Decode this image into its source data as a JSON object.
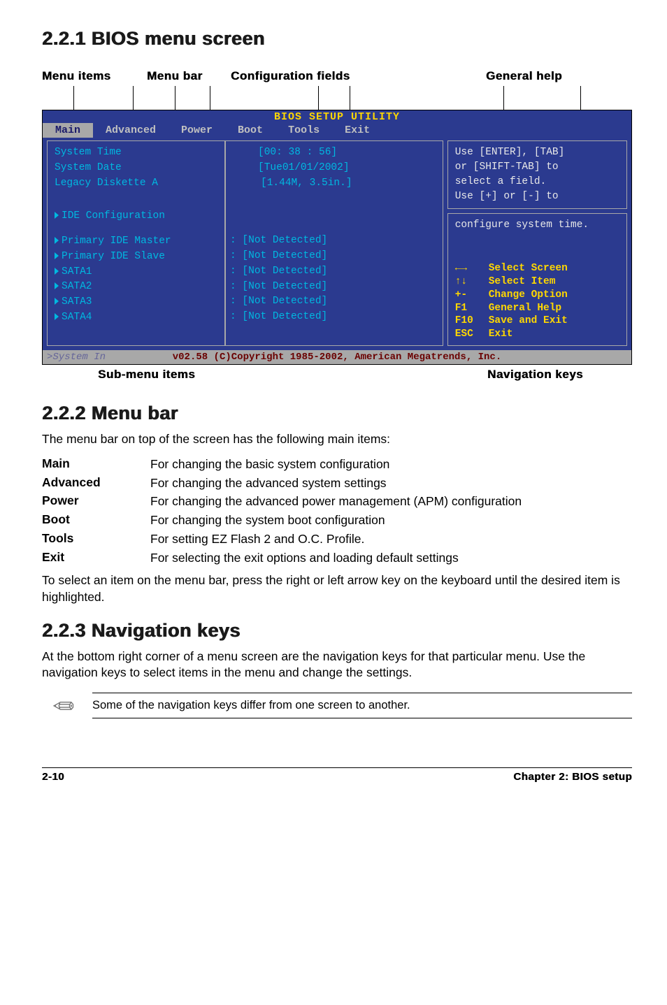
{
  "sec_221_title": "2.2.1  BIOS menu screen",
  "annot_top": {
    "menu_items": "Menu items",
    "menu_bar": "Menu bar",
    "config_fields": "Configuration fields",
    "general_help": "General help"
  },
  "bios": {
    "title": "BIOS SETUP UTILITY",
    "menubar": [
      "Main",
      "Advanced",
      "Power",
      "Boot",
      "Tools",
      "Exit"
    ],
    "left_labels": {
      "sys_time": "System Time",
      "sys_date": "System Date",
      "legacy": "Legacy Diskette A",
      "ide_cfg": "IDE Configuration",
      "pim": "Primary IDE Master",
      "pis": "Primary IDE Slave",
      "s1": "SATA1",
      "s2": "SATA2",
      "s3": "SATA3",
      "s4": "SATA4"
    },
    "left_values": {
      "time": "[00: 38 : 56]",
      "date": "[Tue01/01/2002]",
      "legacy": "[1.44M, 3.5in.]",
      "nd": ": [Not Detected]"
    },
    "help_top": {
      "l1": "Use [ENTER], [TAB]",
      "l2": "or [SHIFT-TAB] to",
      "l3": "select a field.",
      "l4": "Use [+] or [-] to",
      "l5": "configure system time."
    },
    "keys": [
      {
        "k": "←→",
        "l": "Select Screen"
      },
      {
        "k": "↑↓",
        "l": "Select Item"
      },
      {
        "k": "+-",
        "l": "Change Option"
      },
      {
        "k": "F1",
        "l": "General Help"
      },
      {
        "k": "F10",
        "l": "Save and Exit"
      },
      {
        "k": "ESC",
        "l": "Exit"
      }
    ],
    "footer_sys": ">System In",
    "footer_copy": "v02.58 (C)Copyright 1985-2002, American Megatrends, Inc."
  },
  "annot_bot": {
    "sub_menu": "Sub-menu items",
    "nav_keys": "Navigation keys"
  },
  "sec_222": {
    "title": "2.2.2  Menu bar",
    "intro": "The menu bar on top of the screen has the following main items:",
    "defs": [
      {
        "t": "Main",
        "d": "For changing the basic system configuration"
      },
      {
        "t": "Advanced",
        "d": "For changing the advanced system settings"
      },
      {
        "t": "Power",
        "d": "For changing the advanced power management (APM) configuration"
      },
      {
        "t": "Boot",
        "d": "For changing the system boot configuration"
      },
      {
        "t": "Tools",
        "d": "For setting EZ Flash 2 and O.C. Profile."
      },
      {
        "t": "Exit",
        "d": "For selecting the exit options and loading default settings"
      }
    ],
    "outro": "To select an item on the menu bar, press the right or left arrow key on the keyboard until the desired item is highlighted."
  },
  "sec_223": {
    "title": "2.2.3  Navigation keys",
    "body": "At the bottom right corner of a menu screen are the navigation keys for that particular menu. Use the navigation keys to select items in the menu and change the settings.",
    "note": "Some of the navigation keys differ from one screen to another."
  },
  "footer": {
    "left": "2-10",
    "right": "Chapter 2: BIOS setup"
  }
}
